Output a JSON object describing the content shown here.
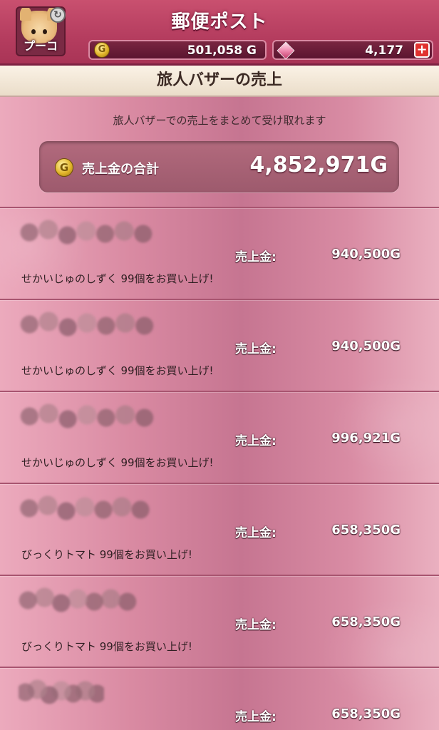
{
  "header": {
    "title": "郵便ポスト",
    "character_name": "プーコ",
    "gold": "501,058 G",
    "gems": "4,177",
    "plus": "+",
    "swap_glyph": "↻",
    "coin_glyph": "G"
  },
  "section": {
    "title": "旅人バザーの売上"
  },
  "summary": {
    "subtitle": "旅人バザーでの売上をまとめて受け取れます",
    "total_label": "売上金の合計",
    "total_value": "4,852,971G"
  },
  "sales": [
    {
      "label": "売上金:",
      "amount": "940,500G",
      "description": "せかいじゅのしずく 99個をお買い上げ!"
    },
    {
      "label": "売上金:",
      "amount": "940,500G",
      "description": "せかいじゅのしずく 99個をお買い上げ!"
    },
    {
      "label": "売上金:",
      "amount": "996,921G",
      "description": "せかいじゅのしずく 99個をお買い上げ!"
    },
    {
      "label": "売上金:",
      "amount": "658,350G",
      "description": "びっくりトマト 99個をお買い上げ!"
    },
    {
      "label": "売上金:",
      "amount": "658,350G",
      "description": "びっくりトマト 99個をお買い上げ!"
    },
    {
      "label": "売上金:",
      "amount": "658,350G",
      "description": ""
    }
  ],
  "colors": {
    "header_bg": "#b63e60",
    "content_bg": "#d98aa2",
    "section_bg": "#fbf2e6",
    "gold_coin": "#e2b52a",
    "plus_button": "#e0322f"
  }
}
